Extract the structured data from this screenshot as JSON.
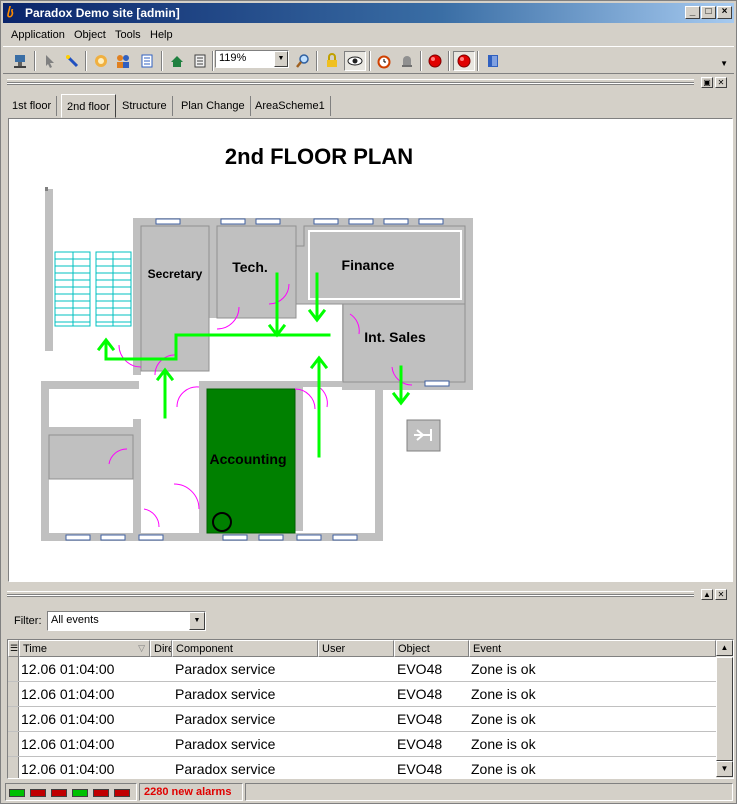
{
  "window": {
    "title": "Paradox Demo site [admin]",
    "buttons": [
      "_",
      "□",
      "×"
    ]
  },
  "menu": {
    "items": [
      "Application",
      "Object",
      "Tools",
      "Help"
    ]
  },
  "toolbar": {
    "zoom_value": "119%",
    "icons": [
      "connect-icon",
      "pointer-icon",
      "wand-icon",
      "hand-icon",
      "users-icon",
      "list-icon",
      "refresh-icon",
      "notes-icon",
      "magnifier-icon",
      "lock-icon",
      "eye-icon",
      "alarm-clock-icon",
      "bell-icon",
      "record-icon",
      "record-pressed-icon",
      "door-icon"
    ]
  },
  "tabs": [
    {
      "label": "1st floor",
      "active": false
    },
    {
      "label": "2nd floor",
      "active": true
    },
    {
      "label": "Structure",
      "active": false
    },
    {
      "label": "Plan Change",
      "active": false
    },
    {
      "label": "AreaScheme1",
      "active": false
    }
  ],
  "plan": {
    "title": "2nd FLOOR PLAN",
    "rooms": {
      "secretary": "Secretary",
      "tech": "Tech.",
      "finance": "Finance",
      "int_sales": "Int. Sales",
      "accounting": "Accounting"
    },
    "colors": {
      "wall": "#c0c0c0",
      "accounting": "#008000",
      "arrow": "#00ff00",
      "door": "#ff00ff",
      "stairs": "#00c0c0"
    }
  },
  "filter": {
    "label": "Filter:",
    "value": "All events"
  },
  "grid": {
    "columns": [
      "Time",
      "Dire",
      "Component",
      "User",
      "Object",
      "Event"
    ],
    "rows": [
      {
        "time": "12.06 01:04:00",
        "component": "Paradox service",
        "user": "",
        "object": "EVO48",
        "event": "Zone  is ok"
      },
      {
        "time": "12.06 01:04:00",
        "component": "Paradox service",
        "user": "",
        "object": "EVO48",
        "event": "Zone  is ok"
      },
      {
        "time": "12.06 01:04:00",
        "component": "Paradox service",
        "user": "",
        "object": "EVO48",
        "event": "Zone  is ok"
      },
      {
        "time": "12.06 01:04:00",
        "component": "Paradox service",
        "user": "",
        "object": "EVO48",
        "event": "Zone  is ok"
      },
      {
        "time": "12.06 01:04:00",
        "component": "Paradox service",
        "user": "",
        "object": "EVO48",
        "event": "Zone  is ok"
      }
    ]
  },
  "status": {
    "alarms": "2280 new alarms",
    "led_colors": [
      "green",
      "red",
      "red",
      "green",
      "red",
      "red"
    ]
  }
}
